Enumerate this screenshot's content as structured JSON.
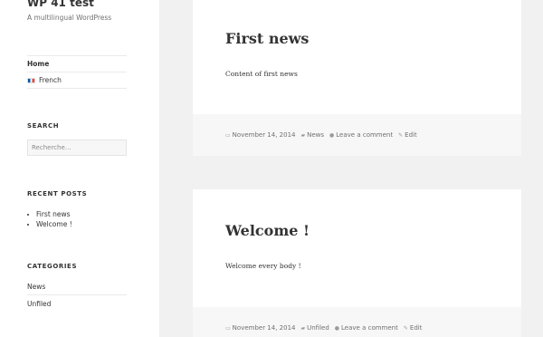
{
  "site": {
    "title": "WP 41 test",
    "description": "A multilingual WordPress"
  },
  "nav": {
    "home": "Home",
    "french": "French"
  },
  "search": {
    "title": "SEARCH",
    "placeholder": "Recherche…"
  },
  "recent_posts": {
    "title": "RECENT POSTS",
    "items": [
      "First news",
      "Welcome !"
    ]
  },
  "categories": {
    "title": "CATEGORIES",
    "items": [
      "News",
      "Unfiled"
    ]
  },
  "posts": [
    {
      "title": "First news",
      "content": "Content of first news",
      "date": "November 14, 2014",
      "category": "News",
      "comment": "Leave a comment",
      "edit": "Edit"
    },
    {
      "title": "Welcome !",
      "content": "Welcome every body !",
      "date": "November 14, 2014",
      "category": "Unfiled",
      "comment": "Leave a comment",
      "edit": "Edit"
    }
  ],
  "icons": {
    "date": "calendar-icon",
    "category": "folder-icon",
    "comment": "comment-icon",
    "edit": "pencil-icon"
  }
}
